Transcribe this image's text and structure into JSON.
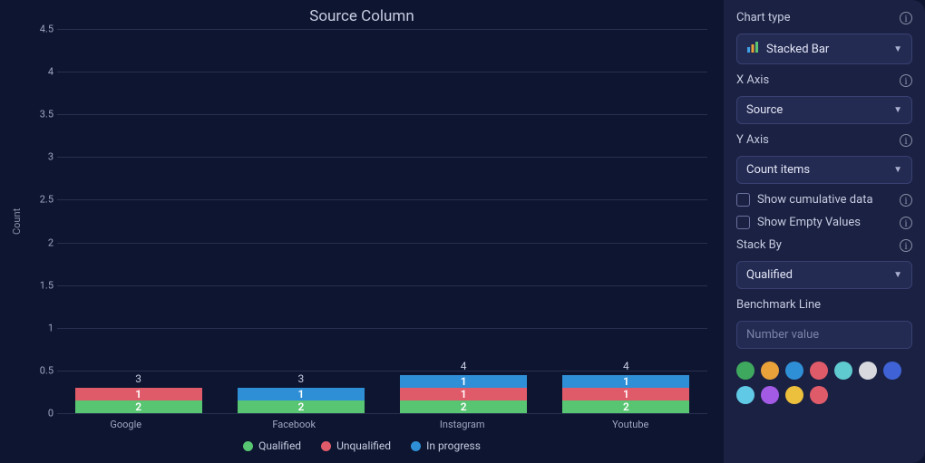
{
  "chart_data": {
    "type": "bar",
    "stacked": true,
    "title": "Source Column",
    "ylabel": "Count",
    "ylim": [
      0,
      4.5
    ],
    "yticks": [
      0,
      0.5,
      1,
      1.5,
      2,
      2.5,
      3,
      3.5,
      4,
      4.5
    ],
    "categories": [
      "Google",
      "Facebook",
      "Instagram",
      "Youtube"
    ],
    "series": [
      {
        "name": "Qualified",
        "color": "#58c572",
        "values": [
          2,
          2,
          2,
          2
        ]
      },
      {
        "name": "Unqualified",
        "color": "#e05b6a",
        "values": [
          1,
          0,
          1,
          1
        ]
      },
      {
        "name": "In progress",
        "color": "#2f8fd6",
        "values": [
          0,
          1,
          1,
          1
        ]
      }
    ],
    "totals": [
      3,
      3,
      4,
      4
    ]
  },
  "sidebar": {
    "chart_type": {
      "label": "Chart type",
      "value": "Stacked Bar"
    },
    "x_axis": {
      "label": "X Axis",
      "value": "Source"
    },
    "y_axis": {
      "label": "Y Axis",
      "value": "Count items"
    },
    "show_cumulative": {
      "label": "Show cumulative data",
      "checked": false
    },
    "show_empty": {
      "label": "Show Empty Values",
      "checked": false
    },
    "stack_by": {
      "label": "Stack By",
      "value": "Qualified"
    },
    "benchmark": {
      "label": "Benchmark Line",
      "placeholder": "Number value"
    },
    "colors": [
      "#3fa85f",
      "#e9a23a",
      "#2f8fd6",
      "#e05b6a",
      "#5fcad0",
      "#d7d9de",
      "#3f63d6",
      "#60c9e6",
      "#a35be6",
      "#ecbf3c",
      "#e05b6a"
    ]
  }
}
